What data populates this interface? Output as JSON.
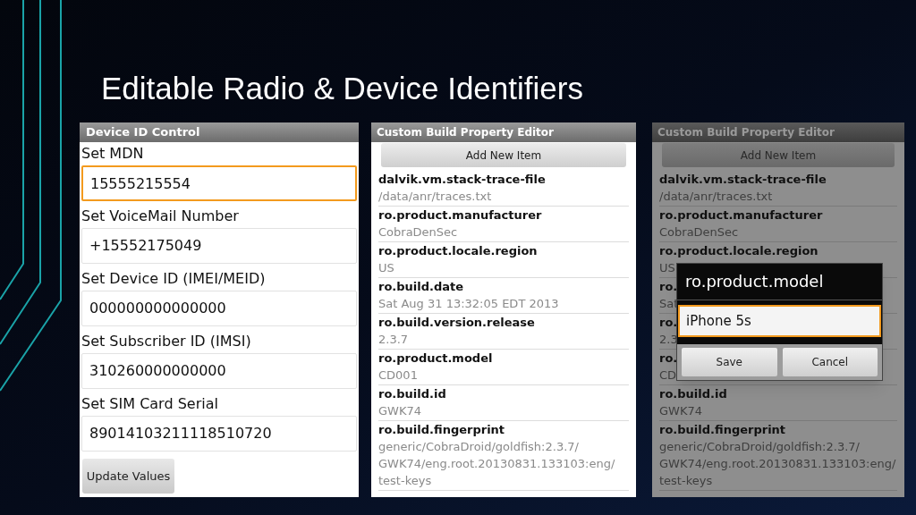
{
  "title": "Editable Radio & Device Identifiers",
  "device_id_panel": {
    "title": "Device ID Control",
    "fields": [
      {
        "label": "Set MDN",
        "value": "15555215554",
        "focused": true
      },
      {
        "label": "Set VoiceMail Number",
        "value": "+15552175049",
        "focused": false
      },
      {
        "label": "Set Device ID (IMEI/MEID)",
        "value": "000000000000000",
        "focused": false
      },
      {
        "label": "Set Subscriber ID (IMSI)",
        "value": "310260000000000",
        "focused": false
      },
      {
        "label": "Set SIM Card Serial",
        "value": "89014103211118510720",
        "focused": false
      }
    ],
    "button": "Update Values"
  },
  "build_editor": {
    "title": "Custom Build Property Editor",
    "add_button": "Add New Item",
    "properties": [
      {
        "key": "dalvik.vm.stack-trace-file",
        "value": "/data/anr/traces.txt"
      },
      {
        "key": "ro.product.manufacturer",
        "value": "CobraDenSec"
      },
      {
        "key": "ro.product.locale.region",
        "value": "US"
      },
      {
        "key": "ro.build.date",
        "value": "Sat Aug 31 13:32:05 EDT 2013"
      },
      {
        "key": "ro.build.version.release",
        "value": "2.3.7"
      },
      {
        "key": "ro.product.model",
        "value": "CD001"
      },
      {
        "key": "ro.build.id",
        "value": "GWK74"
      },
      {
        "key": "ro.build.fingerprint",
        "value": "generic/CobraDroid/goldfish:2.3.7/ GWK74/eng.root.20130831.133103:eng/ test-keys"
      }
    ]
  },
  "build_editor_with_dialog": {
    "title": "Custom Build Property Editor",
    "add_button": "Add New Item",
    "properties": [
      {
        "key": "dalvik.vm.stack-trace-file",
        "value": "/data/anr/traces.txt"
      },
      {
        "key": "ro.product.manufacturer",
        "value": "CobraDenSec"
      },
      {
        "key": "ro.product.locale.region",
        "value": "US"
      },
      {
        "key": "ro.",
        "value": "Sat"
      },
      {
        "key": "ro.",
        "value": "2.3"
      },
      {
        "key": "ro.",
        "value": "CD"
      },
      {
        "key": "ro.build.id",
        "value": "GWK74"
      },
      {
        "key": "ro.build.fingerprint",
        "value": "generic/CobraDroid/goldfish:2.3.7/ GWK74/eng.root.20130831.133103:eng/ test-keys"
      }
    ],
    "dialog": {
      "title": "ro.product.model",
      "value": "iPhone 5s",
      "buttons": [
        "Save",
        "Cancel"
      ]
    }
  }
}
